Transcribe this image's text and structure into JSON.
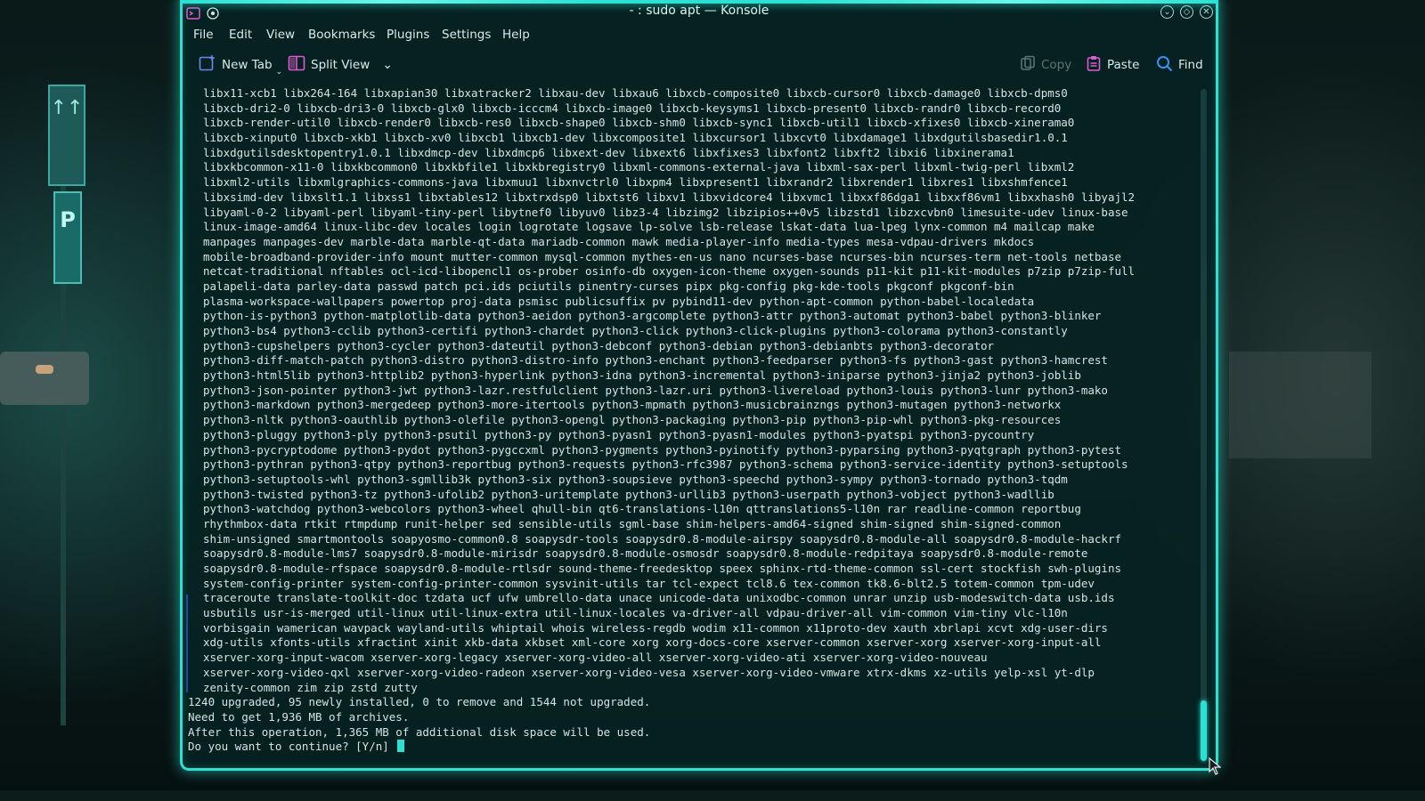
{
  "window": {
    "title": "- : sudo apt — Konsole",
    "accent": "#2ce0d3"
  },
  "menu": [
    "File",
    "Edit",
    "View",
    "Bookmarks",
    "Plugins",
    "Settings",
    "Help"
  ],
  "toolbar": {
    "new_tab": "New Tab",
    "split_view": "Split View",
    "copy": "Copy",
    "paste": "Paste",
    "find": "Find"
  },
  "terminal": {
    "package_lines": [
      "libx11-xcb1 libx264-164 libxapian30 libxatracker2 libxau-dev libxau6 libxcb-composite0 libxcb-cursor0 libxcb-damage0 libxcb-dpms0",
      "libxcb-dri2-0 libxcb-dri3-0 libxcb-glx0 libxcb-icccm4 libxcb-image0 libxcb-keysyms1 libxcb-present0 libxcb-randr0 libxcb-record0",
      "libxcb-render-util0 libxcb-render0 libxcb-res0 libxcb-shape0 libxcb-shm0 libxcb-sync1 libxcb-util1 libxcb-xfixes0 libxcb-xinerama0",
      "libxcb-xinput0 libxcb-xkb1 libxcb-xv0 libxcb1 libxcb1-dev libxcomposite1 libxcursor1 libxcvt0 libxdamage1 libxdgutilsbasedir1.0.1",
      "libxdgutilsdesktopentry1.0.1 libxdmcp-dev libxdmcp6 libxext-dev libxext6 libxfixes3 libxfont2 libxft2 libxi6 libxinerama1",
      "libxkbcommon-x11-0 libxkbcommon0 libxkbfile1 libxkbregistry0 libxml-commons-external-java libxml-sax-perl libxml-twig-perl libxml2",
      "libxml2-utils libxmlgraphics-commons-java libxmuu1 libxnvctrl0 libxpm4 libxpresent1 libxrandr2 libxrender1 libxres1 libxshmfence1",
      "libxsimd-dev libxslt1.1 libxss1 libxtables12 libxtrxdsp0 libxtst6 libxv1 libxvidcore4 libxvmc1 libxxf86dga1 libxxf86vm1 libxxhash0 libyajl2",
      "libyaml-0-2 libyaml-perl libyaml-tiny-perl libytnef0 libyuv0 libz3-4 libzimg2 libzipios++0v5 libzstd1 libzxcvbn0 limesuite-udev linux-base",
      "linux-image-amd64 linux-libc-dev locales login logrotate logsave lp-solve lsb-release lskat-data lua-lpeg lynx-common m4 mailcap make",
      "manpages manpages-dev marble-data marble-qt-data mariadb-common mawk media-player-info media-types mesa-vdpau-drivers mkdocs",
      "mobile-broadband-provider-info mount mutter-common mysql-common mythes-en-us nano ncurses-base ncurses-bin ncurses-term net-tools netbase",
      "netcat-traditional nftables ocl-icd-libopencl1 os-prober osinfo-db oxygen-icon-theme oxygen-sounds p11-kit p11-kit-modules p7zip p7zip-full",
      "palapeli-data parley-data passwd patch pci.ids pciutils pinentry-curses pipx pkg-config pkg-kde-tools pkgconf pkgconf-bin",
      "plasma-workspace-wallpapers powertop proj-data psmisc publicsuffix pv pybind11-dev python-apt-common python-babel-localedata",
      "python-is-python3 python-matplotlib-data python3-aeidon python3-argcomplete python3-attr python3-automat python3-babel python3-blinker",
      "python3-bs4 python3-cclib python3-certifi python3-chardet python3-click python3-click-plugins python3-colorama python3-constantly",
      "python3-cupshelpers python3-cycler python3-dateutil python3-debconf python3-debian python3-debianbts python3-decorator",
      "python3-diff-match-patch python3-distro python3-distro-info python3-enchant python3-feedparser python3-fs python3-gast python3-hamcrest",
      "python3-html5lib python3-httplib2 python3-hyperlink python3-idna python3-incremental python3-iniparse python3-jinja2 python3-joblib",
      "python3-json-pointer python3-jwt python3-lazr.restfulclient python3-lazr.uri python3-livereload python3-louis python3-lunr python3-mako",
      "python3-markdown python3-mergedeep python3-more-itertools python3-mpmath python3-musicbrainzngs python3-mutagen python3-networkx",
      "python3-nltk python3-oauthlib python3-olefile python3-opengl python3-packaging python3-pip python3-pip-whl python3-pkg-resources",
      "python3-pluggy python3-ply python3-psutil python3-py python3-pyasn1 python3-pyasn1-modules python3-pyatspi python3-pycountry",
      "python3-pycryptodome python3-pydot python3-pygccxml python3-pygments python3-pyinotify python3-pyparsing python3-pyqtgraph python3-pytest",
      "python3-pythran python3-qtpy python3-reportbug python3-requests python3-rfc3987 python3-schema python3-service-identity python3-setuptools",
      "python3-setuptools-whl python3-sgmllib3k python3-six python3-soupsieve python3-speechd python3-sympy python3-tornado python3-tqdm",
      "python3-twisted python3-tz python3-ufolib2 python3-uritemplate python3-urllib3 python3-userpath python3-vobject python3-wadllib",
      "python3-watchdog python3-webcolors python3-wheel qhull-bin qt6-translations-l10n qttranslations5-l10n rar readline-common reportbug",
      "rhythmbox-data rtkit rtmpdump runit-helper sed sensible-utils sgml-base shim-helpers-amd64-signed shim-signed shim-signed-common",
      "shim-unsigned smartmontools soapyosmo-common0.8 soapysdr-tools soapysdr0.8-module-airspy soapysdr0.8-module-all soapysdr0.8-module-hackrf",
      "soapysdr0.8-module-lms7 soapysdr0.8-module-mirisdr soapysdr0.8-module-osmosdr soapysdr0.8-module-redpitaya soapysdr0.8-module-remote",
      "soapysdr0.8-module-rfspace soapysdr0.8-module-rtlsdr sound-theme-freedesktop speex sphinx-rtd-theme-common ssl-cert stockfish swh-plugins",
      "system-config-printer system-config-printer-common sysvinit-utils tar tcl-expect tcl8.6 tex-common tk8.6-blt2.5 totem-common tpm-udev",
      "traceroute translate-toolkit-doc tzdata ucf ufw umbrello-data unace unicode-data unixodbc-common unrar unzip usb-modeswitch-data usb.ids",
      "usbutils usr-is-merged util-linux util-linux-extra util-linux-locales va-driver-all vdpau-driver-all vim-common vim-tiny vlc-l10n",
      "vorbisgain wamerican wavpack wayland-utils whiptail whois wireless-regdb wodim x11-common x11proto-dev xauth xbrlapi xcvt xdg-user-dirs",
      "xdg-utils xfonts-utils xfractint xinit xkb-data xkbset xml-core xorg xorg-docs-core xserver-common xserver-xorg xserver-xorg-input-all",
      "xserver-xorg-input-wacom xserver-xorg-legacy xserver-xorg-video-all xserver-xorg-video-ati xserver-xorg-video-nouveau",
      "xserver-xorg-video-qxl xserver-xorg-video-radeon xserver-xorg-video-vesa xserver-xorg-video-vmware xtrx-dkms xz-utils yelp-xsl yt-dlp",
      "zenity-common zim zip zstd zutty"
    ],
    "summary": "1240 upgraded, 95 newly installed, 0 to remove and 1544 not upgraded.",
    "need_to_get": "Need to get 1,936 MB of archives.",
    "disk_space": "After this operation, 1,365 MB of additional disk space will be used.",
    "prompt": "Do you want to continue? [Y/n] "
  }
}
